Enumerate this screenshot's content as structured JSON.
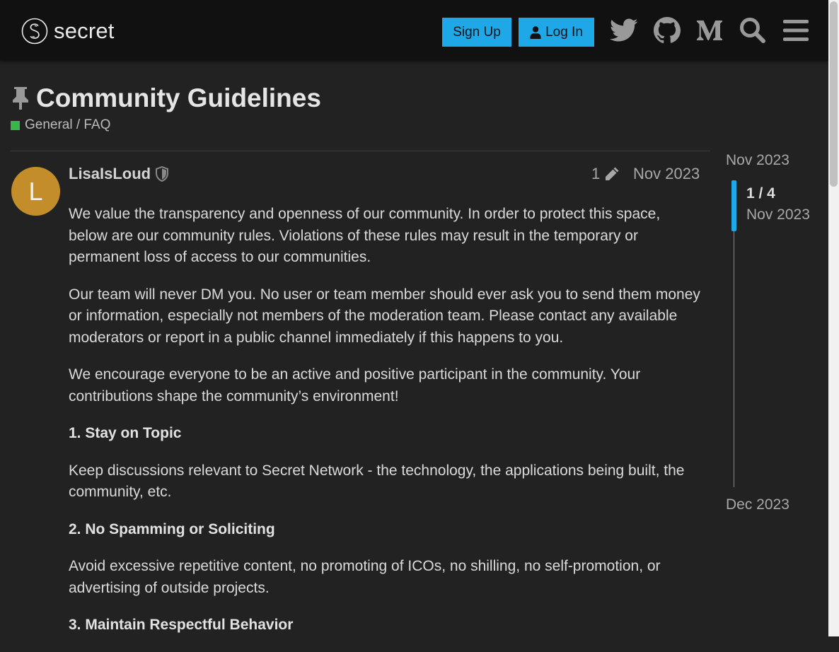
{
  "header": {
    "logo_text": "secret",
    "signup_label": "Sign Up",
    "login_label": "Log In",
    "icons": [
      "twitter-icon",
      "github-icon",
      "medium-icon",
      "search-icon",
      "menu-icon"
    ]
  },
  "topic": {
    "title": "Community Guidelines",
    "category": "General / FAQ",
    "category_color": "#3ab54a"
  },
  "post": {
    "avatar_letter": "L",
    "avatar_color": "#c38e2a",
    "username": "LisaIsLoud",
    "edit_count": "1",
    "date": "Nov 2023",
    "paragraphs": [
      "We value the transparency and openness of our community. In order to protect this space, below are our community rules. Violations of these rules may result in the temporary or permanent loss of access to our communities.",
      "Our team will never DM you. No user or team member should ever ask you to send them money or information, especially not members of the moderation team. Please contact any available moderators or report in a public channel immediately if this happens to you.",
      "We encourage everyone to be an active and positive participant in the community. Your contributions shape the community’s environment!"
    ],
    "sections": [
      {
        "heading": "1. Stay on Topic",
        "text": "Keep discussions relevant to Secret Network - the technology, the applications being built, the community, etc."
      },
      {
        "heading": "2. No Spamming or Soliciting",
        "text": "Avoid excessive repetitive content, no promoting of ICOs, no shilling, no self-promotion, or advertising of outside projects."
      },
      {
        "heading": "3. Maintain Respectful Behavior"
      }
    ]
  },
  "timeline": {
    "start_date": "Nov 2023",
    "position": "1 / 4",
    "position_date": "Nov 2023",
    "end_date": "Dec 2023",
    "accent_color": "#1ea8e8"
  }
}
